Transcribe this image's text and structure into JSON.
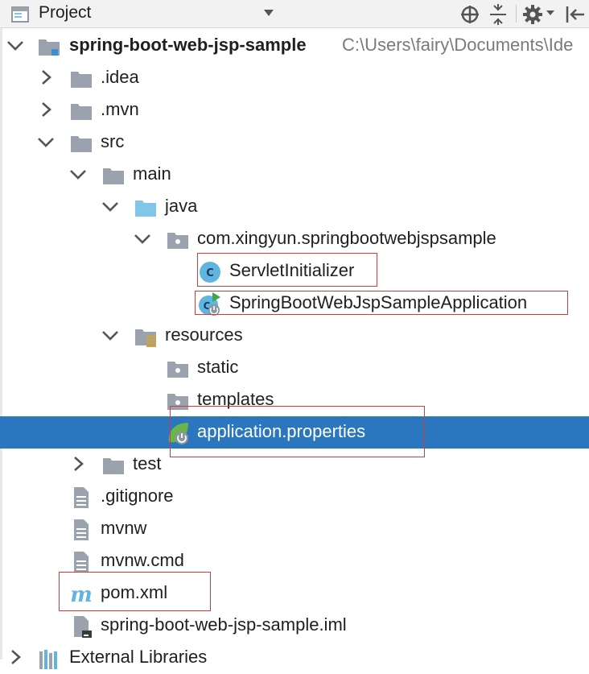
{
  "panel": {
    "title": "Project",
    "icons": [
      "project-view-icon",
      "dropdown-arrow-icon",
      "locate-icon",
      "collapse-all-icon",
      "gear-icon",
      "hide-panel-icon"
    ]
  },
  "tree": {
    "root": {
      "label": "spring-boot-web-jsp-sample",
      "path": "C:\\Users\\fairy\\Documents\\Ide"
    },
    "idea": ".idea",
    "mvn": ".mvn",
    "src": "src",
    "main": "main",
    "java": "java",
    "package": "com.xingyun.springbootwebjspsample",
    "servlet_initializer": "ServletInitializer",
    "application_class": "SpringBootWebJspSampleApplication",
    "resources": "resources",
    "static": "static",
    "templates": "templates",
    "application_properties": "application.properties",
    "test": "test",
    "gitignore": ".gitignore",
    "mvnw": "mvnw",
    "mvnw_cmd": "mvnw.cmd",
    "pom": "pom.xml",
    "iml": "spring-boot-web-jsp-sample.iml",
    "external_libraries": "External Libraries"
  },
  "selected_item": "application.properties",
  "colors": {
    "selection": "#2a76bf",
    "highlight_border": "#d23b3b",
    "folder": "#9aa3ad",
    "source_folder": "#7fc6e8",
    "class_icon": "#5fb5e0"
  }
}
